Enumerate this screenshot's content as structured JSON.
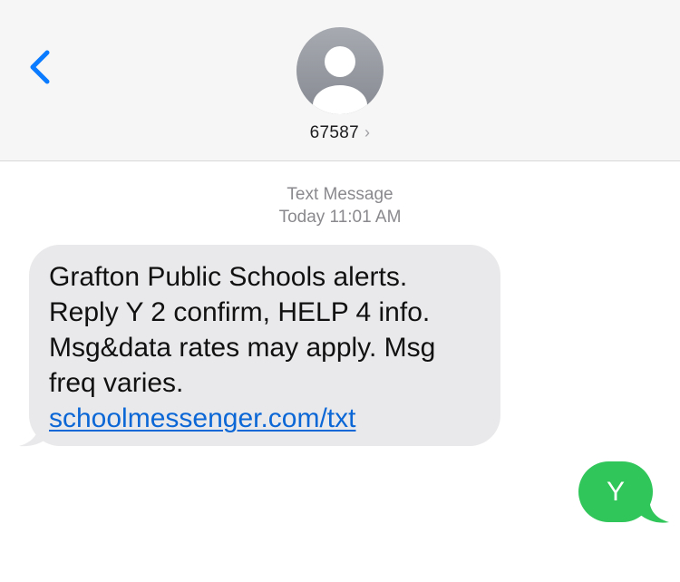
{
  "header": {
    "back_icon": "chevron-left-icon",
    "avatar_icon": "person-icon",
    "contact_number": "67587",
    "contact_chevron": "›",
    "accent": "#0a7aff"
  },
  "thread": {
    "service_label": "Text Message",
    "timestamp": "Today 11:01 AM"
  },
  "messages": [
    {
      "direction": "incoming",
      "lines": [
        "Grafton Public Schools alerts.",
        "Reply Y 2 confirm, HELP 4 info.",
        "Msg&data rates may apply. Msg",
        "freq varies."
      ],
      "link": "schoolmessenger.com/txt",
      "bubble_color": "#e9e9eb"
    },
    {
      "direction": "outgoing",
      "text": "Y",
      "bubble_color": "#30c65a"
    }
  ]
}
